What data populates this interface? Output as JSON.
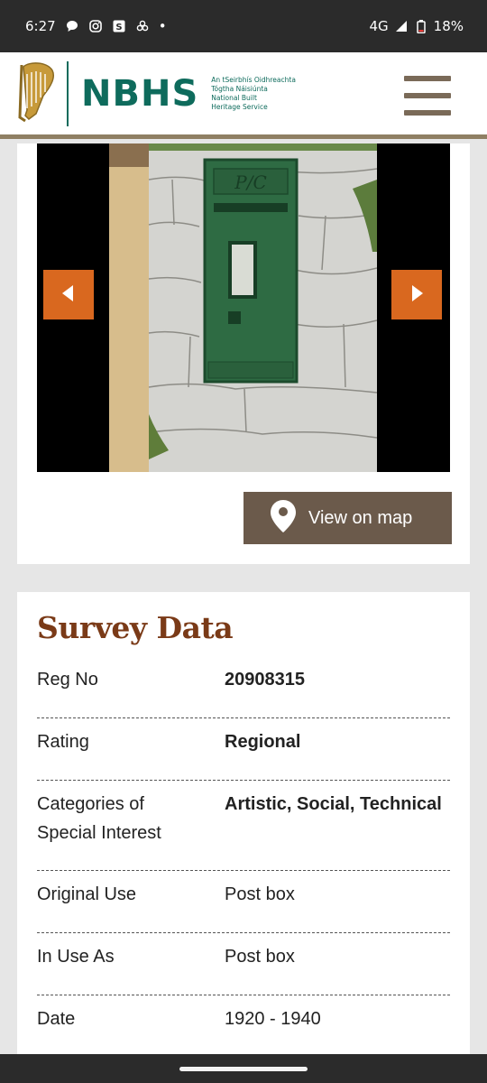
{
  "status_bar": {
    "time": "6:27",
    "network": "4G",
    "battery": "18%",
    "dot": "•"
  },
  "header": {
    "logo_text": "NBHS",
    "logo_sub": [
      "An tSeirbhís Oidhreachta",
      "Tógtha Náisiúnta",
      "National Built",
      "Heritage Service"
    ]
  },
  "gallery": {
    "photo_text": "P/C",
    "view_on_map_label": "View on map"
  },
  "survey": {
    "title": "Survey Data",
    "rows": [
      {
        "key": "Reg No",
        "value": "20908315"
      },
      {
        "key": "Rating",
        "value": "Regional"
      },
      {
        "key_line1": "Categories of",
        "key_line2": "Special Interest",
        "value": "Artistic, Social, Technical"
      },
      {
        "key": "Original Use",
        "value": "Post box"
      },
      {
        "key": "In Use As",
        "value": "Post box"
      },
      {
        "key": "Date",
        "value": "1920 - 1940"
      }
    ]
  },
  "colors": {
    "brand_green": "#0e6b5c",
    "accent_orange": "#d9681f",
    "title_brown": "#7a3a17",
    "button_brown": "#6b5a4b"
  }
}
